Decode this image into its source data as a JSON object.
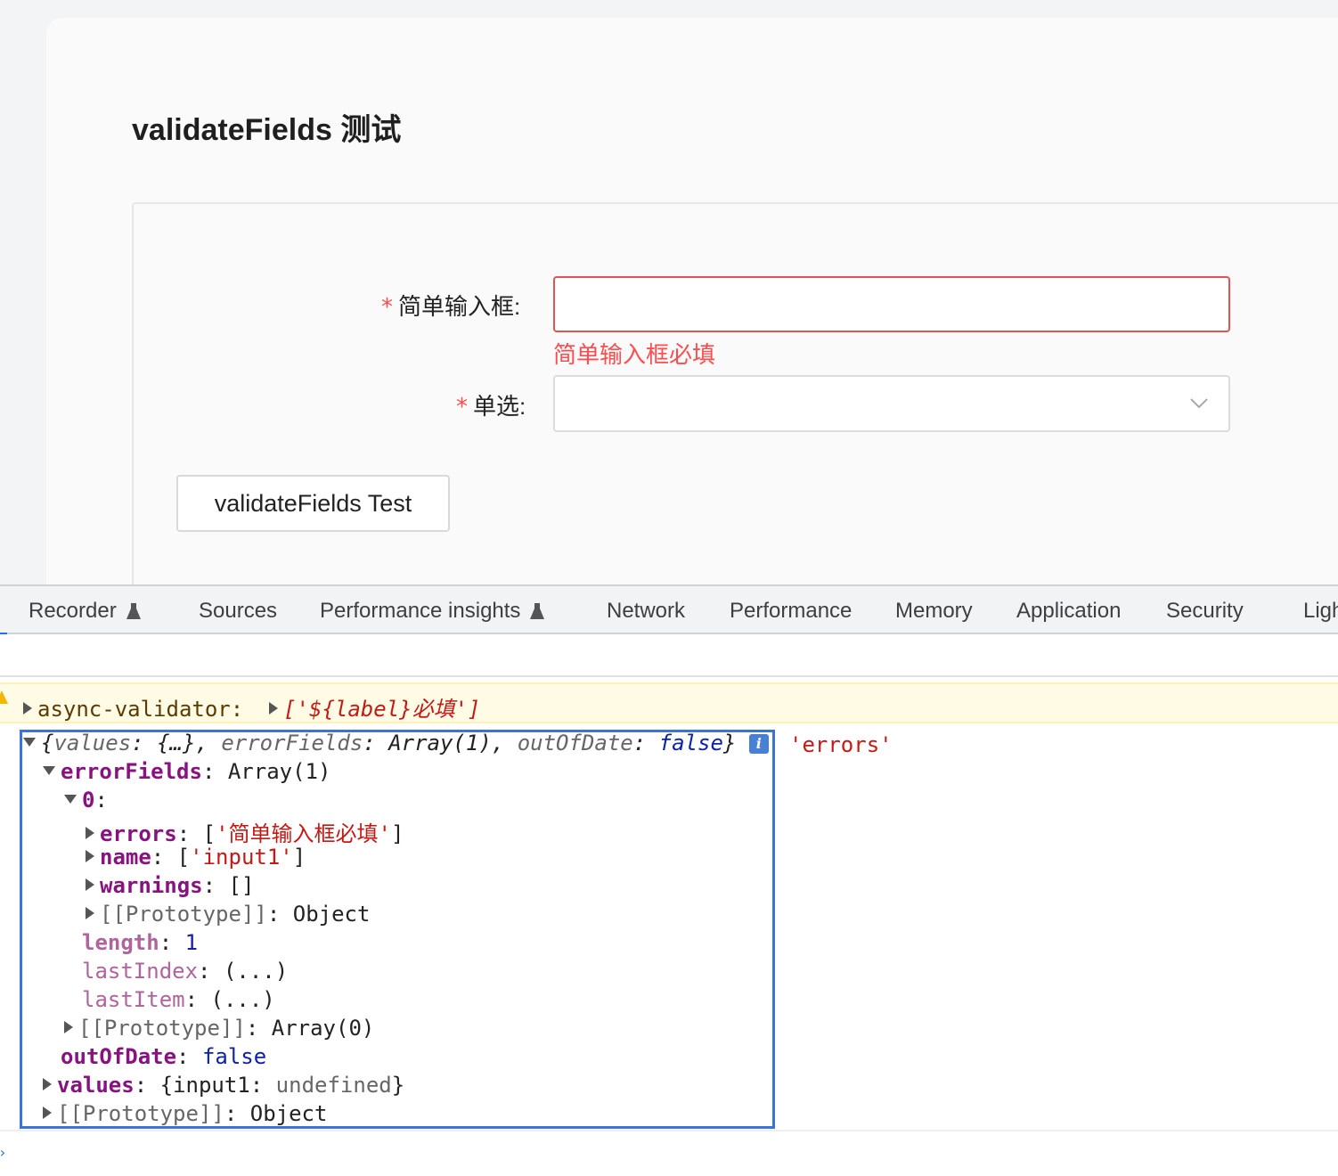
{
  "page": {
    "title": "validateFields 测试",
    "form": {
      "field1": {
        "required_mark": "*",
        "label": "简单输入框:",
        "value": "",
        "error": "简单输入框必填"
      },
      "field2": {
        "required_mark": "*",
        "label": "单选:",
        "value": ""
      },
      "submit_label": "validateFields Test"
    }
  },
  "devtools": {
    "tabs": [
      {
        "label": "Recorder",
        "icon": "flask-icon"
      },
      {
        "label": "Sources"
      },
      {
        "label": "Performance insights",
        "icon": "flask-icon"
      },
      {
        "label": "Network"
      },
      {
        "label": "Performance"
      },
      {
        "label": "Memory"
      },
      {
        "label": "Application"
      },
      {
        "label": "Security"
      },
      {
        "label": "Ligh"
      }
    ],
    "console": {
      "warning": {
        "source": "async-validator:",
        "value": "['${label}必填']"
      },
      "object_summary": {
        "open": "{",
        "values_key": "values",
        "values_val": "{…}",
        "errorFields_key": "errorFields",
        "errorFields_val": "Array(1)",
        "outOfDate_key": "outOfDate",
        "outOfDate_val": "false",
        "close": "}"
      },
      "side_string": "'errors'",
      "tree": {
        "errorFields_key": "errorFields",
        "errorFields_val": "Array(1)",
        "index0": "0",
        "errors_key": "errors",
        "errors_val": "'简单输入框必填'",
        "name_key": "name",
        "name_val": "'input1'",
        "warnings_key": "warnings",
        "warnings_val": "[]",
        "proto_key": "[[Prototype]]",
        "proto_obj": "Object",
        "length_key": "length",
        "length_val": "1",
        "lastIndex_key": "lastIndex",
        "lastIndex_val": "(...)",
        "lastItem_key": "lastItem",
        "lastItem_val": "(...)",
        "proto_arr_val": "Array(0)",
        "outOfDate_key": "outOfDate",
        "outOfDate_val": "false",
        "values_key": "values",
        "values_inner_key": "input1",
        "values_inner_val": "undefined",
        "root_proto_val": "Object"
      }
    }
  }
}
